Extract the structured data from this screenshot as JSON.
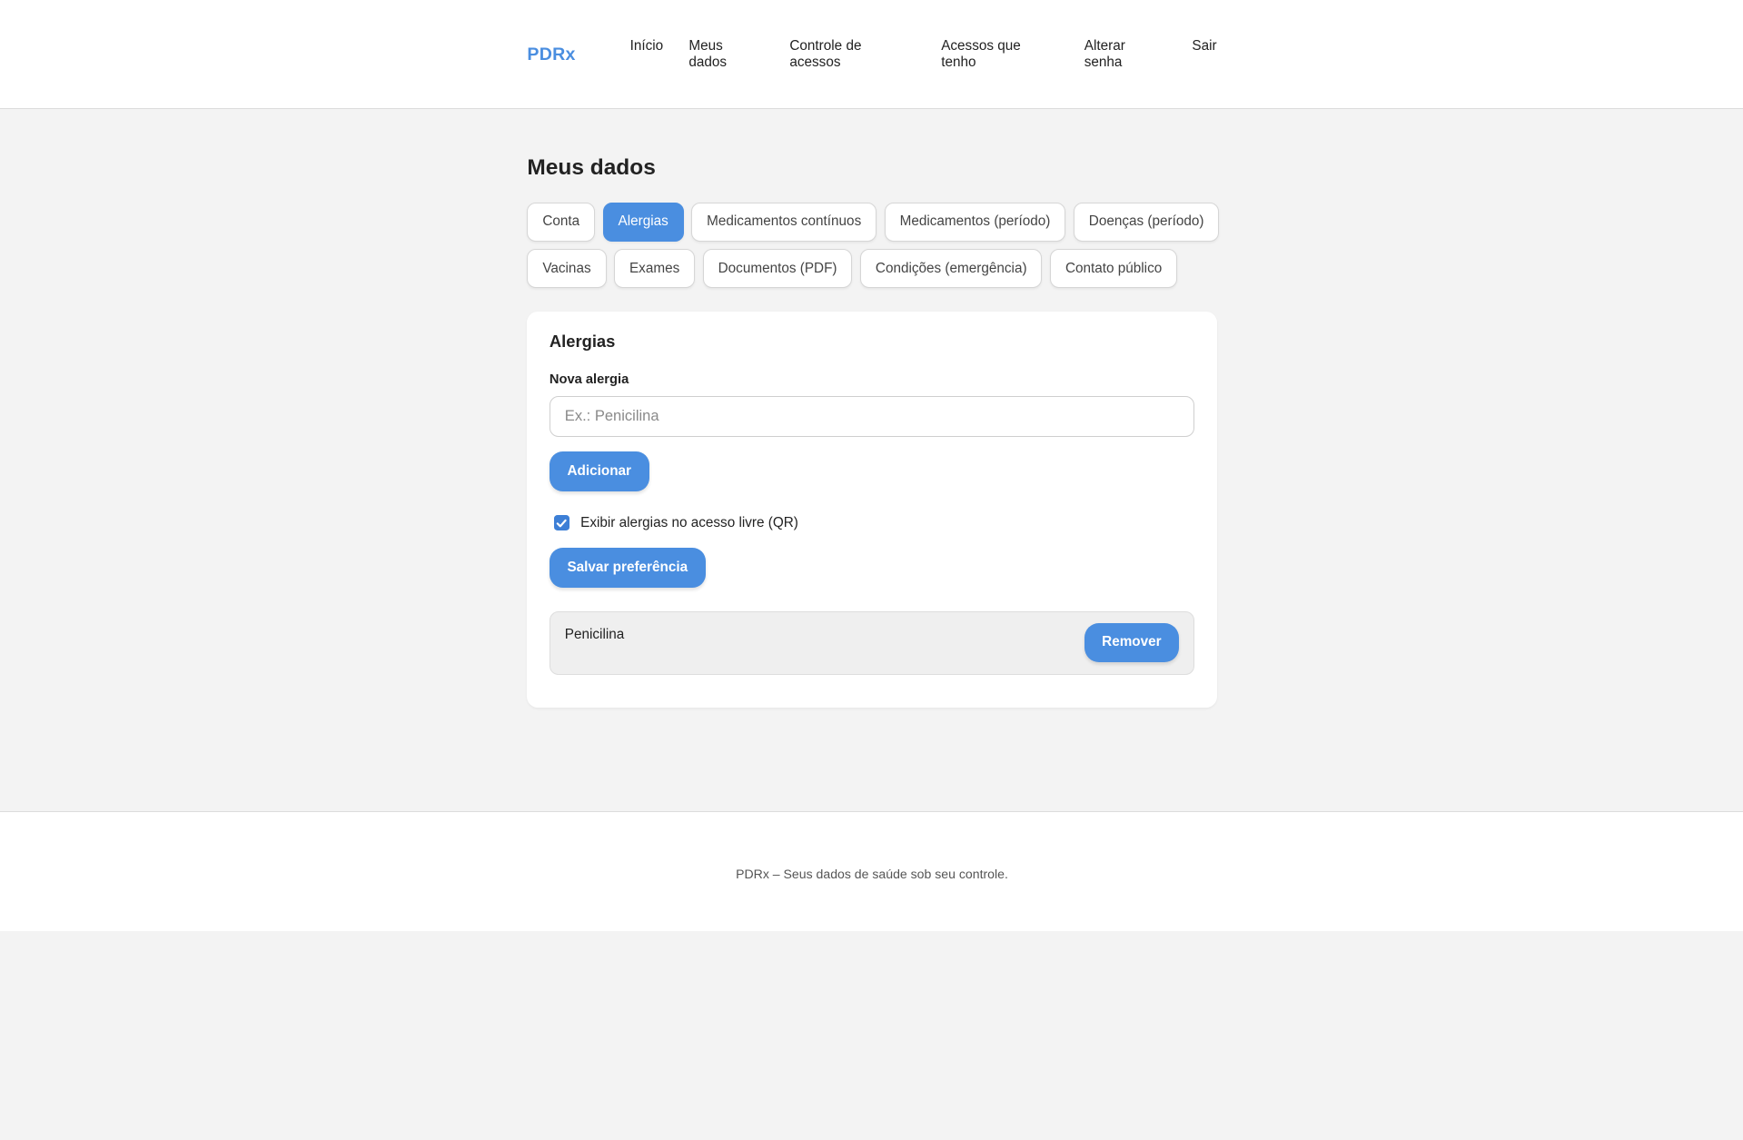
{
  "header": {
    "brand": "PDRx",
    "nav": [
      {
        "label": "Início"
      },
      {
        "label": "Meus dados"
      },
      {
        "label": "Controle de acessos"
      },
      {
        "label": "Acessos que tenho"
      },
      {
        "label": "Alterar senha"
      },
      {
        "label": "Sair"
      }
    ]
  },
  "main": {
    "title": "Meus dados",
    "tabs": [
      {
        "label": "Conta",
        "active": false
      },
      {
        "label": "Alergias",
        "active": true
      },
      {
        "label": "Medicamentos contínuos",
        "active": false
      },
      {
        "label": "Medicamentos (período)",
        "active": false
      },
      {
        "label": "Doenças (período)",
        "active": false
      },
      {
        "label": "Vacinas",
        "active": false
      },
      {
        "label": "Exames",
        "active": false
      },
      {
        "label": "Documentos (PDF)",
        "active": false
      },
      {
        "label": "Condições (emergência)",
        "active": false
      },
      {
        "label": "Contato público",
        "active": false
      }
    ]
  },
  "card": {
    "title": "Alergias",
    "field_label": "Nova alergia",
    "input_value": "",
    "input_placeholder": "Ex.: Penicilina",
    "add_button": "Adicionar",
    "checkbox_label": "Exibir alergias no acesso livre (QR)",
    "checkbox_checked": true,
    "save_button": "Salvar preferência",
    "items": [
      {
        "name": "Penicilina",
        "remove_label": "Remover"
      }
    ]
  },
  "footer": {
    "text": "PDRx – Seus dados de saúde sob seu controle."
  },
  "colors": {
    "accent": "#4a8ee0",
    "checkbox": "#3d7fd6"
  }
}
